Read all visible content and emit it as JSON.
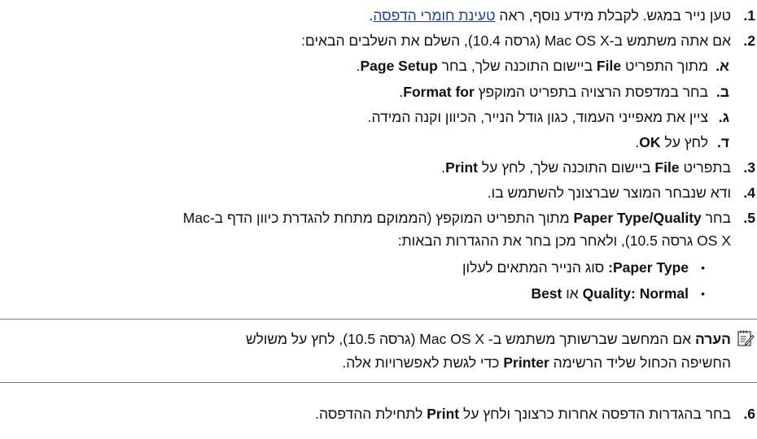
{
  "steps": {
    "s1": {
      "num": "1.",
      "pre": "טען נייר במגש. לקבלת מידע נוסף, ראה",
      "link": "טעינת חומרי הדפסה",
      "post": "."
    },
    "s2": {
      "num": "2.",
      "text": "אם אתה משתמש ב-Mac OS X (גרסה 10.4), השלם את השלבים הבאים:"
    },
    "s2a": {
      "num": "א.",
      "pre": "מתוך התפריט",
      "b1": "File",
      "mid": "ביישום התוכנה שלך, בחר",
      "b2": "Page Setup",
      "post": "."
    },
    "s2b": {
      "num": "ב.",
      "pre": "בחר במדפסת הרצויה בתפריט המוקפץ",
      "b1": "Format for",
      "post": "."
    },
    "s2c": {
      "num": "ג.",
      "text": "ציין את מאפייני העמוד, כגון גודל הנייר, הכיוון וקנה המידה."
    },
    "s2d": {
      "num": "ד.",
      "pre": "לחץ על",
      "b1": "OK",
      "post": "."
    },
    "s3": {
      "num": "3.",
      "pre": "בתפריט",
      "b1": "File",
      "mid": "ביישום התוכנה שלך, לחץ על",
      "b2": "Print",
      "post": "."
    },
    "s4": {
      "num": "4.",
      "text": "ודא שנבחר המוצר שברצונך להשתמש בו."
    },
    "s5": {
      "num": "5.",
      "pre": "בחר",
      "b1": "Paper Type/Quality",
      "line1_rest": "מתוך התפריט המוקפץ (הממוקם מתחת להגדרת כיוון הדף ב-Mac",
      "line2": "OS X גרסה 10.5), ולאחר מכן בחר את ההגדרות הבאות:"
    },
    "bullet1": {
      "b1": "Paper Type:",
      "rest": "סוג הנייר המתאים לעלון"
    },
    "bullet2": {
      "b1": "Quality:",
      "b2": "Normal",
      "mid": "או",
      "b3": "Best"
    },
    "s6": {
      "num": "6.",
      "pre": "בחר בהגדרות הדפסה אחרות כרצונך ולחץ על",
      "b1": "Print",
      "post": "לתחילת ההדפסה."
    }
  },
  "note": {
    "label": "הערה",
    "line1": "אם המחשב שברשותך משתמש ב- Mac OS X (גרסה 10.5), לחץ על משולש",
    "line2_pre": "החשיפה הכחול שליד הרשימה",
    "line2_bold": "Printer",
    "line2_post": "כדי לגשת לאפשרויות אלה."
  }
}
